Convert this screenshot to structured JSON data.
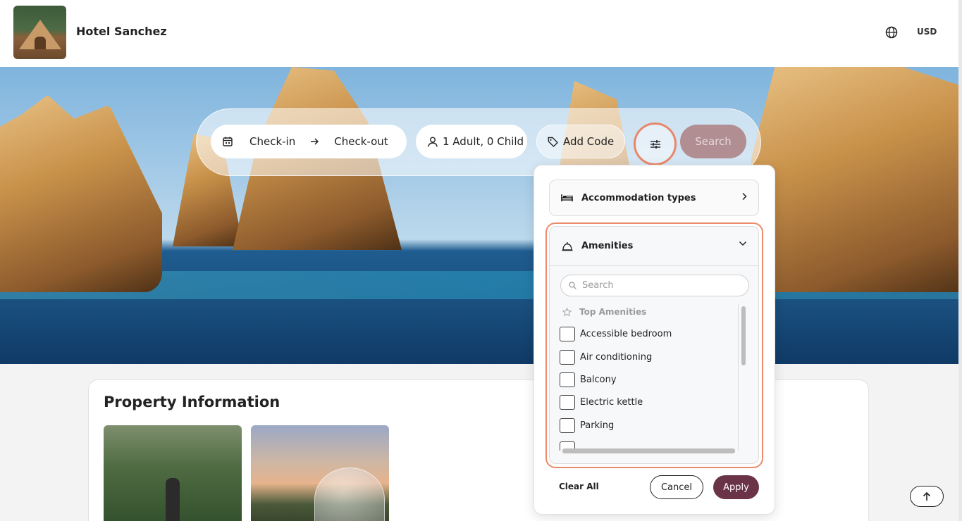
{
  "header": {
    "hotel_name": "Hotel Sanchez",
    "currency": "USD",
    "logo_icon": "tent-photo",
    "language_icon": "globe-icon"
  },
  "search_bar": {
    "checkin_label": "Check-in",
    "checkout_label": "Check-out",
    "guests_label": "1 Adult, 0 Child",
    "code_label": "Add Code",
    "search_label": "Search"
  },
  "property": {
    "title": "Property Information"
  },
  "filter_panel": {
    "accommodation_label": "Accommodation types",
    "amenities_label": "Amenities",
    "search_placeholder": "Search",
    "top_amenities_label": "Top Amenities",
    "amenities": [
      {
        "label": "Accessible bedroom",
        "checked": false
      },
      {
        "label": "Air conditioning",
        "checked": false
      },
      {
        "label": "Balcony",
        "checked": false
      },
      {
        "label": "Electric kettle",
        "checked": false
      },
      {
        "label": "Parking",
        "checked": false
      }
    ],
    "clear_all_label": "Clear All",
    "cancel_label": "Cancel",
    "apply_label": "Apply"
  },
  "colors": {
    "accent": "#6b3347",
    "highlight_outline": "#ec8b6c",
    "search_disabled": "#b08e92"
  }
}
